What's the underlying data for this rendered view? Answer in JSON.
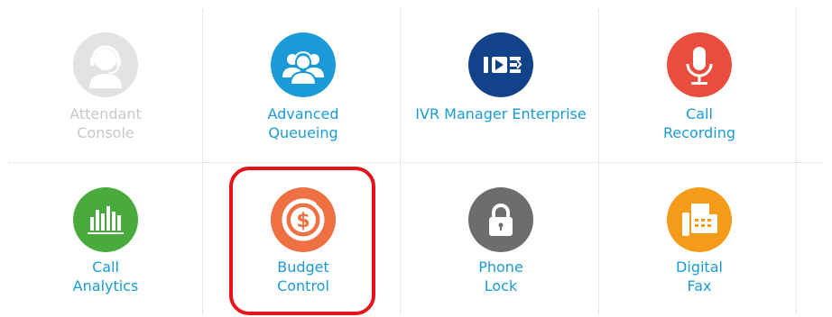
{
  "tiles": [
    {
      "label": "Attendant\nConsole",
      "icon": "headset-agent-icon",
      "color": "#e3e3e3",
      "enabled": false
    },
    {
      "label": "Advanced\nQueueing",
      "icon": "agents-group-icon",
      "color": "#1a9bd7",
      "enabled": true
    },
    {
      "label": "IVR Manager Enterprise",
      "icon": "ivr-icon",
      "color": "#12428a",
      "enabled": true
    },
    {
      "label": "Call\nRecording",
      "icon": "microphone-icon",
      "color": "#e94d3d",
      "enabled": true
    },
    {
      "label": "Call\nAnalytics",
      "icon": "bar-chart-icon",
      "color": "#4aab3d",
      "enabled": true
    },
    {
      "label": "Budget\nControl",
      "icon": "dollar-coin-icon",
      "color": "#ef7042",
      "enabled": true,
      "highlighted": true
    },
    {
      "label": "Phone\nLock",
      "icon": "padlock-icon",
      "color": "#6d6d6d",
      "enabled": true
    },
    {
      "label": "Digital\nFax",
      "icon": "fax-icon",
      "color": "#f49b19",
      "enabled": true
    }
  ],
  "highlight_color": "#e8121a"
}
